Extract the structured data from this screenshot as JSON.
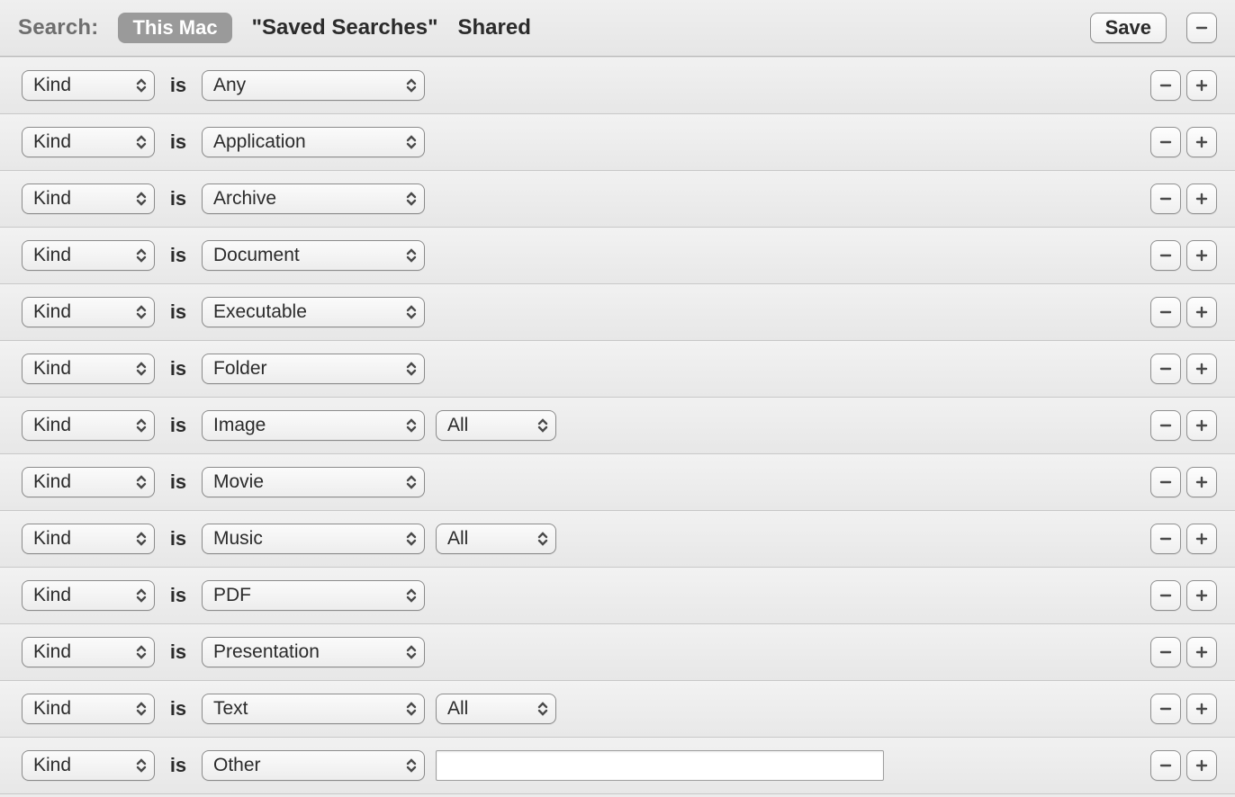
{
  "toolbar": {
    "search_label": "Search:",
    "scope_selected": "This Mac",
    "scope_options": [
      "\"Saved Searches\"",
      "Shared"
    ],
    "save_label": "Save"
  },
  "operators": {
    "is": "is"
  },
  "rows": [
    {
      "attr": "Kind",
      "value": "Any"
    },
    {
      "attr": "Kind",
      "value": "Application"
    },
    {
      "attr": "Kind",
      "value": "Archive"
    },
    {
      "attr": "Kind",
      "value": "Document"
    },
    {
      "attr": "Kind",
      "value": "Executable"
    },
    {
      "attr": "Kind",
      "value": "Folder"
    },
    {
      "attr": "Kind",
      "value": "Image",
      "sub": "All"
    },
    {
      "attr": "Kind",
      "value": "Movie"
    },
    {
      "attr": "Kind",
      "value": "Music",
      "sub": "All"
    },
    {
      "attr": "Kind",
      "value": "PDF"
    },
    {
      "attr": "Kind",
      "value": "Presentation"
    },
    {
      "attr": "Kind",
      "value": "Text",
      "sub": "All"
    },
    {
      "attr": "Kind",
      "value": "Other",
      "text_input": ""
    }
  ]
}
